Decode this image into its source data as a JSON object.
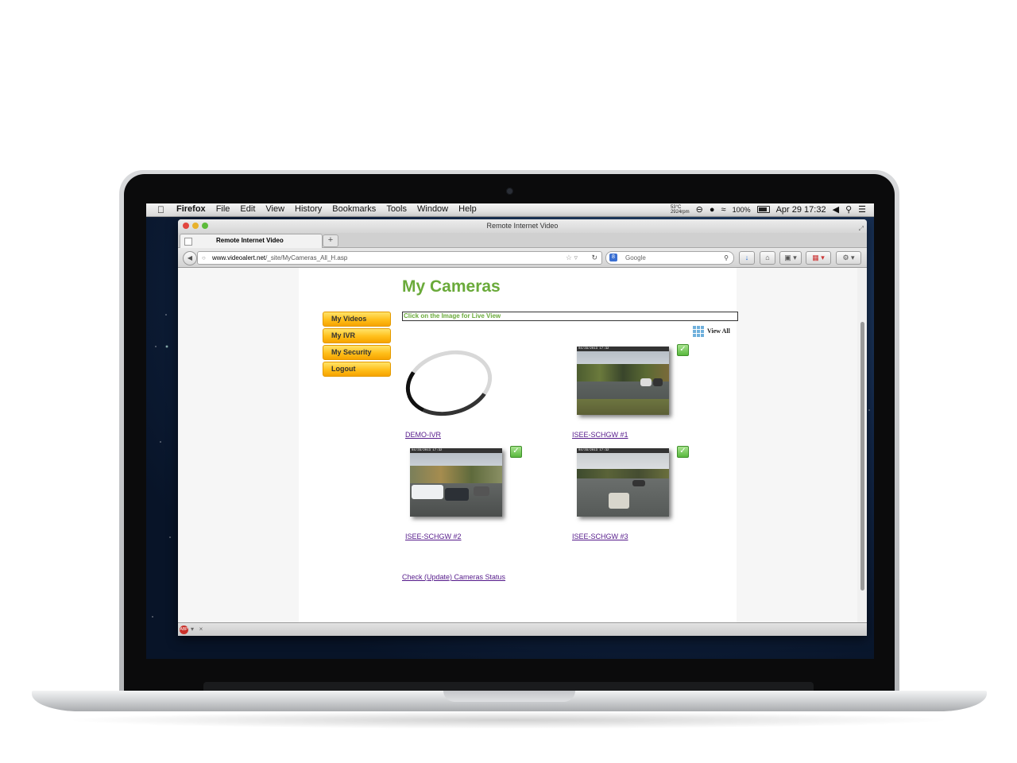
{
  "menubar": {
    "app_name": "Firefox",
    "menus": [
      "File",
      "Edit",
      "View",
      "History",
      "Bookmarks",
      "Tools",
      "Window",
      "Help"
    ],
    "temp_line1": "53°C",
    "temp_line2": "2924rpm",
    "battery": "100%",
    "datetime": "Apr 29  17:32"
  },
  "window": {
    "title": "Remote Internet Video",
    "tab_label": "Remote Internet Video",
    "url_domain": "www.videoalert.net",
    "url_path": "/_site/MyCameras_All_H.asp",
    "search_placeholder": "Google"
  },
  "page": {
    "title": "My Cameras",
    "instruction": "Click on the Image for Live View",
    "view_all": "View All",
    "nav": [
      "My Videos",
      "My IVR",
      "My Security",
      "Logout"
    ],
    "cameras": [
      {
        "name": "DEMO-IVR",
        "timestamp": ""
      },
      {
        "name": "ISEE-SCHGW #1",
        "timestamp": "04/29/2013 17:32"
      },
      {
        "name": "ISEE-SCHGW #2",
        "timestamp": "04/29/2013 17:32"
      },
      {
        "name": "ISEE-SCHGW #3",
        "timestamp": "04/29/2013 17:32"
      }
    ],
    "status_link": "Check (Update) Cameras Status"
  },
  "colors": {
    "title_green": "#6aaa3a",
    "nav_button": "#ffbf1a",
    "link_visited": "#551a8b"
  }
}
